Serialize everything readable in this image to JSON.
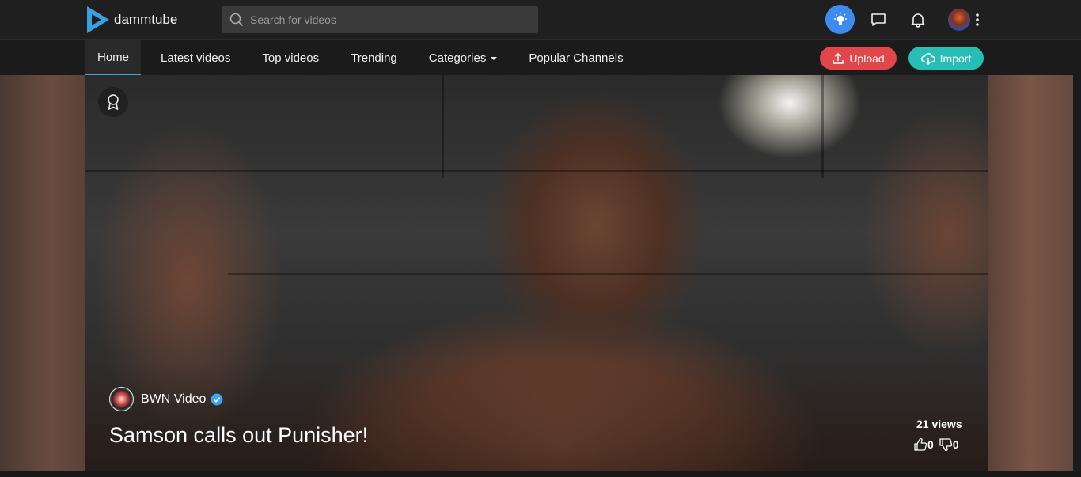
{
  "app": {
    "name": "dammtube"
  },
  "search": {
    "placeholder": "Search for videos"
  },
  "nav": {
    "items": [
      {
        "label": "Home",
        "active": true
      },
      {
        "label": "Latest videos"
      },
      {
        "label": "Top videos"
      },
      {
        "label": "Trending"
      },
      {
        "label": "Categories"
      },
      {
        "label": "Popular Channels"
      }
    ]
  },
  "actions": {
    "upload_label": "Upload",
    "import_label": "Import"
  },
  "icons": {
    "theme": "lightbulb-icon",
    "messages": "chat-icon",
    "notifications": "bell-icon",
    "more": "vertical-dots-icon",
    "featured": "award-icon"
  },
  "featured": {
    "channel_name": "BWN Video",
    "title": "Samson calls out Punisher!",
    "views": "21 views",
    "likes": "0",
    "dislikes": "0"
  },
  "colors": {
    "upload": "#e0464a",
    "import": "#27bfb5",
    "accent": "#3d8bf0",
    "active_tab": "#3ea6d6"
  }
}
